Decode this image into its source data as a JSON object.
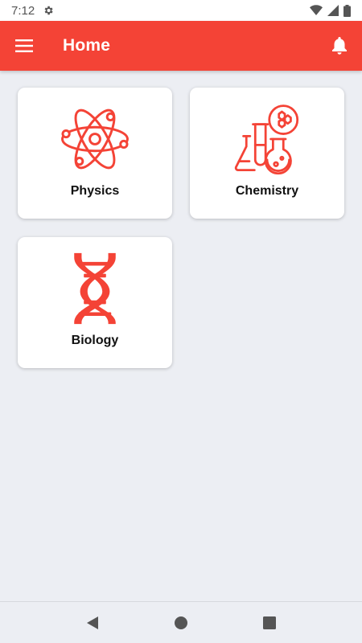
{
  "status_bar": {
    "time": "7:12",
    "icons": [
      "settings-icon",
      "wifi-icon",
      "signal-icon",
      "battery-icon"
    ]
  },
  "app_bar": {
    "title": "Home",
    "menu_icon": "menu-icon",
    "notification_icon": "bell-icon"
  },
  "subjects": [
    {
      "label": "Physics",
      "icon": "atom-icon"
    },
    {
      "label": "Chemistry",
      "icon": "flask-icon"
    },
    {
      "label": "Biology",
      "icon": "dna-icon"
    }
  ],
  "nav_bar": {
    "icons": [
      "back-icon",
      "home-icon",
      "recents-icon"
    ]
  },
  "colors": {
    "primary": "#f44336",
    "background": "#eceef3",
    "card": "#ffffff"
  }
}
